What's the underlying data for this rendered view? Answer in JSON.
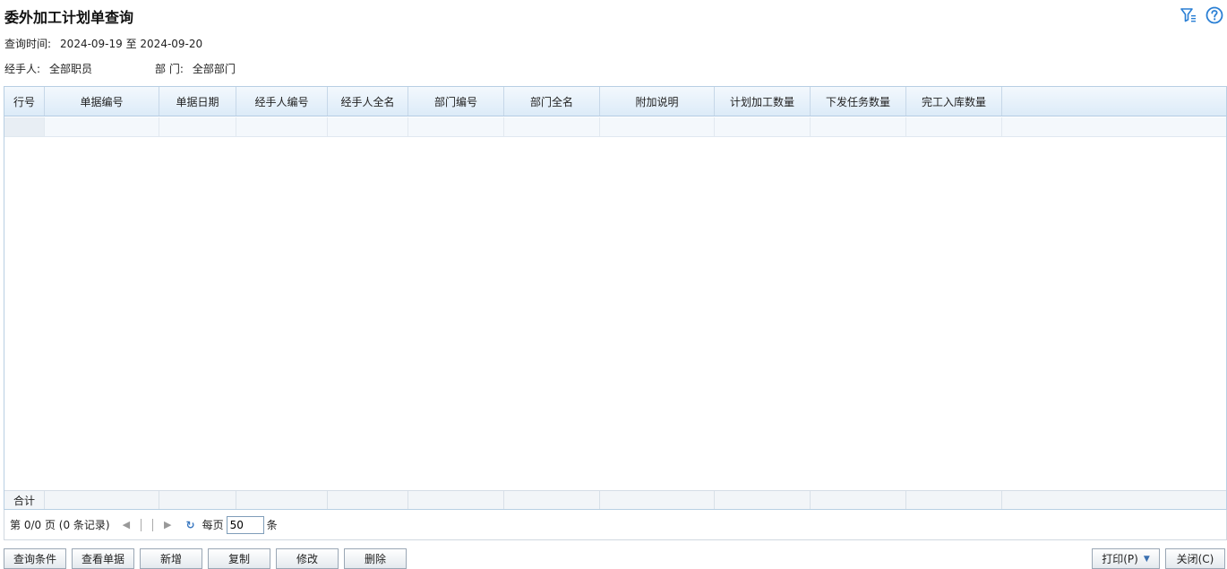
{
  "page": {
    "title": "委外加工计划单查询"
  },
  "icons": {
    "filter": "filter-icon",
    "help": "help-icon",
    "accent": "#2a7fd4"
  },
  "info": {
    "time_label": "查询时间:",
    "time_value": "2024-09-19 至 2024-09-20",
    "handler_label": "经手人:",
    "handler_value": "全部职员",
    "dept_label": "部 门:",
    "dept_value": "全部部门"
  },
  "table": {
    "columns": [
      "行号",
      "单据编号",
      "单据日期",
      "经手人编号",
      "经手人全名",
      "部门编号",
      "部门全名",
      "附加说明",
      "计划加工数量",
      "下发任务数量",
      "完工入库数量"
    ],
    "total_label": "合计"
  },
  "pager": {
    "page_info": "第 0/0 页 (0 条记录)",
    "per_page_label": "每页",
    "per_page_value": "50",
    "unit": "条"
  },
  "buttons": {
    "query_conditions": "查询条件",
    "view_document": "查看单据",
    "add": "新增",
    "copy": "复制",
    "modify": "修改",
    "delete": "删除",
    "print": "打印(P)",
    "close": "关闭(C)"
  }
}
